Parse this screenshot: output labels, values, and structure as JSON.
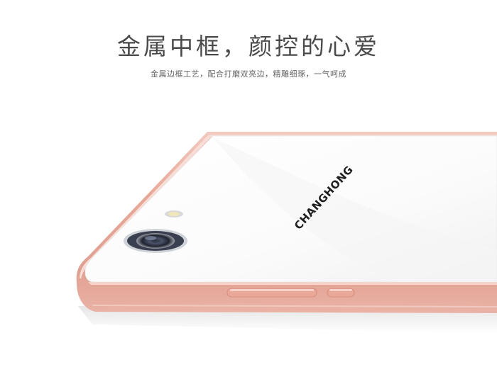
{
  "headline": "金属中框，颜控的心爱",
  "subline": "金属边框工艺，配合打磨双亮边，精雕细琢，一气呵成",
  "brand_logo": "CHANGHONG",
  "colors": {
    "frame": "#e7a79a",
    "frame_highlight": "#f3cdc4",
    "back_glass": "#ffffff",
    "text": "#4a4a4a"
  }
}
